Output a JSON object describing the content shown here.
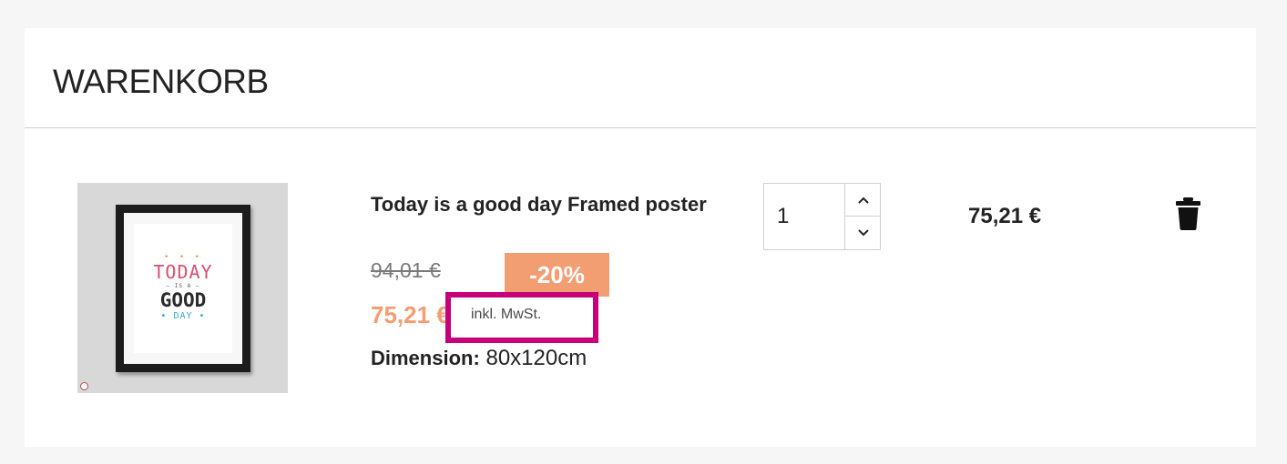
{
  "cart": {
    "title": "WARENKORB"
  },
  "item": {
    "image_alt": "Today is a good day poster",
    "poster_text": {
      "dots": "• • •",
      "line1": "TODAY",
      "line2": "— IS A —",
      "line3": "GOOD",
      "line4": "• DAY •"
    },
    "name": "Today is a good day Framed poster",
    "old_price": "94,01 €",
    "discount": "-20%",
    "new_price": "75,21 €",
    "tax_note": "inkl. MwSt.",
    "dimension_label": "Dimension:",
    "dimension_value": "80x120cm",
    "quantity": "1",
    "line_total": "75,21 €"
  },
  "colors": {
    "accent": "#f39d72",
    "highlight": "#c7007a",
    "text": "#232323"
  },
  "icons": {
    "increment": "chevron-up-icon",
    "decrement": "chevron-down-icon",
    "remove": "trash-icon"
  }
}
